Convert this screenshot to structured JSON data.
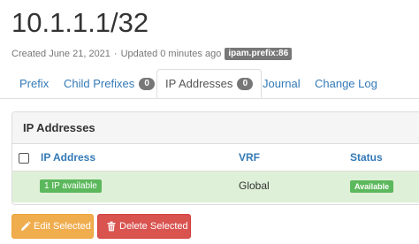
{
  "prefix": {
    "title": "10.1.1.1/32",
    "created": "Created June 21, 2021",
    "separator": "·",
    "updated": "Updated 0 minutes ago",
    "object_id": "ipam.prefix:86"
  },
  "tabs": [
    {
      "label": "Prefix",
      "count": null,
      "active": false
    },
    {
      "label": "Child Prefixes",
      "count": "0",
      "active": false
    },
    {
      "label": "IP Addresses",
      "count": "0",
      "active": true
    },
    {
      "label": "Journal",
      "count": null,
      "active": false
    },
    {
      "label": "Change Log",
      "count": null,
      "active": false
    }
  ],
  "panel": {
    "heading": "IP Addresses",
    "columns": {
      "ip_address": "IP Address",
      "vrf": "VRF",
      "status": "Status"
    },
    "rows": [
      {
        "ip_address": "1 IP available",
        "vrf": "Global",
        "status": "Available"
      }
    ]
  },
  "actions": {
    "edit_selected": "Edit Selected",
    "delete_selected": "Delete Selected"
  },
  "colors": {
    "link": "#337ab7",
    "success": "#5cb85c",
    "row_success_bg": "#dff0d8",
    "warning": "#f0ad4e",
    "danger": "#d9534f",
    "badge": "#777777"
  },
  "icons": {
    "edit": "pencil-icon",
    "delete": "trash-icon"
  }
}
